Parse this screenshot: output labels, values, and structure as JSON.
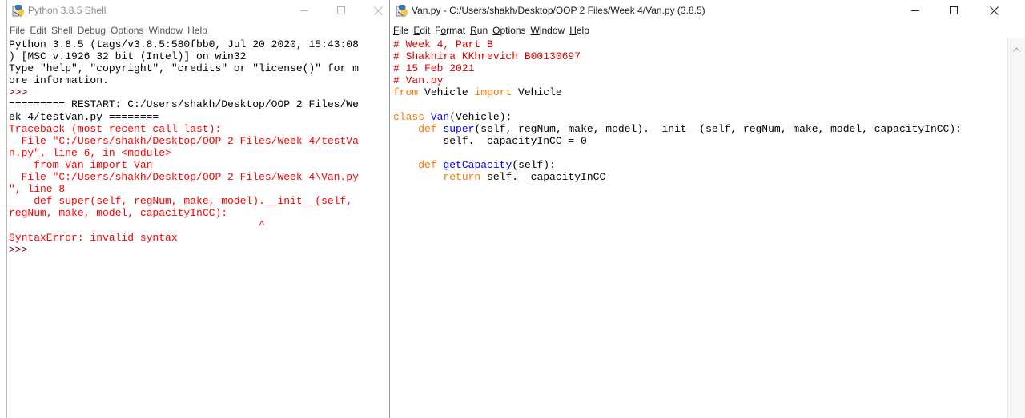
{
  "shell": {
    "title": "Python 3.8.5 Shell",
    "menu": [
      "File",
      "Edit",
      "Shell",
      "Debug",
      "Options",
      "Window",
      "Help"
    ],
    "lines": [
      {
        "t": "Python 3.8.5 (tags/v3.8.5:580fbb0, Jul 20 2020, 15:43:08",
        "c": "plain"
      },
      {
        "t": ") [MSC v.1926 32 bit (Intel)] on win32",
        "c": "plain"
      },
      {
        "t": "Type \"help\", \"copyright\", \"credits\" or \"license()\" for m",
        "c": "plain"
      },
      {
        "t": "ore information.",
        "c": "plain"
      },
      {
        "t": ">>> ",
        "c": "prompt"
      },
      {
        "t": "========= RESTART: C:/Users/shakh/Desktop/OOP 2 Files/We",
        "c": "plain"
      },
      {
        "t": "ek 4/testVan.py ========",
        "c": "plain"
      },
      {
        "t": "Traceback (most recent call last):",
        "c": "err"
      },
      {
        "t": "  File \"C:/Users/shakh/Desktop/OOP 2 Files/Week 4/testVa",
        "c": "err"
      },
      {
        "t": "n.py\", line 6, in <module>",
        "c": "err"
      },
      {
        "t": "    from Van import Van",
        "c": "err"
      },
      {
        "t": "  File \"C:/Users/shakh/Desktop/OOP 2 Files/Week 4\\Van.py",
        "c": "err"
      },
      {
        "t": "\", line 8",
        "c": "err"
      },
      {
        "t": "    def super(self, regNum, make, model).__init__(self,",
        "c": "err"
      },
      {
        "t": "regNum, make, model, capacityInCC):",
        "c": "err"
      },
      {
        "t": "                                        ^",
        "c": "err"
      },
      {
        "t": "SyntaxError: invalid syntax",
        "c": "err"
      },
      {
        "t": ">>> ",
        "c": "prompt"
      }
    ]
  },
  "editor": {
    "title": "Van.py - C:/Users/shakh/Desktop/OOP 2 Files/Week 4/Van.py (3.8.5)",
    "menu": [
      {
        "label": "File",
        "u": "F",
        "rest": "ile"
      },
      {
        "label": "Edit",
        "u": "E",
        "rest": "dit"
      },
      {
        "label": "Format",
        "u": "",
        "pre": "F",
        "mid": "o",
        "post": "rmat"
      },
      {
        "label": "Run",
        "u": "R",
        "rest": "un"
      },
      {
        "label": "Options",
        "u": "O",
        "rest": "ptions"
      },
      {
        "label": "Window",
        "u": "W",
        "rest": "indow"
      },
      {
        "label": "Help",
        "u": "H",
        "rest": "elp"
      }
    ],
    "code": [
      [
        {
          "t": "# Week 4, Part B",
          "c": "comment"
        }
      ],
      [
        {
          "t": "# Shakhira KKhrevich B00130697",
          "c": "comment"
        }
      ],
      [
        {
          "t": "# 15 Feb 2021",
          "c": "comment"
        }
      ],
      [
        {
          "t": "# Van.py",
          "c": "comment"
        }
      ],
      [
        {
          "t": "from",
          "c": "keyword"
        },
        {
          "t": " Vehicle ",
          "c": "plain"
        },
        {
          "t": "import",
          "c": "keyword"
        },
        {
          "t": " Vehicle",
          "c": "plain"
        }
      ],
      [
        {
          "t": "",
          "c": "plain"
        }
      ],
      [
        {
          "t": "class",
          "c": "keyword"
        },
        {
          "t": " ",
          "c": "plain"
        },
        {
          "t": "Van",
          "c": "defname"
        },
        {
          "t": "(Vehicle):",
          "c": "plain"
        }
      ],
      [
        {
          "t": "    ",
          "c": "plain"
        },
        {
          "t": "def",
          "c": "keyword"
        },
        {
          "t": " ",
          "c": "plain"
        },
        {
          "t": "super",
          "c": "defname"
        },
        {
          "t": "(self, regNum, make, model).__init__(self, regNum, make, model, capacityInCC):",
          "c": "plain"
        }
      ],
      [
        {
          "t": "        self.__capacityInCC = 0",
          "c": "plain"
        }
      ],
      [
        {
          "t": "",
          "c": "plain"
        }
      ],
      [
        {
          "t": "    ",
          "c": "plain"
        },
        {
          "t": "def",
          "c": "keyword"
        },
        {
          "t": " ",
          "c": "plain"
        },
        {
          "t": "getCapacity",
          "c": "defname"
        },
        {
          "t": "(self):",
          "c": "plain"
        }
      ],
      [
        {
          "t": "        ",
          "c": "plain"
        },
        {
          "t": "return",
          "c": "keyword"
        },
        {
          "t": " self.__capacityInCC",
          "c": "plain"
        }
      ]
    ]
  },
  "icons": {
    "app": "idle-python-icon",
    "minimize": "minimize-icon",
    "maximize": "maximize-icon",
    "close": "close-icon",
    "scroll_up": "scroll-up-arrow-icon"
  },
  "colors": {
    "comment": "#dd0000",
    "keyword": "#ff7700",
    "definition": "#0000ff",
    "error": "#ff0000",
    "text": "#000000"
  }
}
